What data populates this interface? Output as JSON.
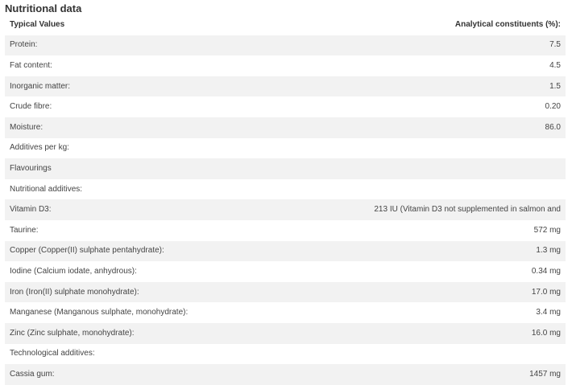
{
  "section": {
    "title": "Nutritional data"
  },
  "table": {
    "headers": {
      "label": "Typical Values",
      "value": "Analytical constituents (%):"
    },
    "rows": [
      {
        "label": "Protein:",
        "value": "7.5"
      },
      {
        "label": "Fat content:",
        "value": "4.5"
      },
      {
        "label": "Inorganic matter:",
        "value": "1.5"
      },
      {
        "label": "Crude fibre:",
        "value": "0.20"
      },
      {
        "label": "Moisture:",
        "value": "86.0"
      },
      {
        "label": "Additives per kg:",
        "value": ""
      },
      {
        "label": "Flavourings",
        "value": ""
      },
      {
        "label": "Nutritional additives:",
        "value": ""
      },
      {
        "label": "Vitamin D3:",
        "value": "213 IU (Vitamin D3 not supplemented in salmon and"
      },
      {
        "label": "Taurine:",
        "value": "572 mg"
      },
      {
        "label": "Copper (Copper(II) sulphate pentahydrate):",
        "value": "1.3 mg"
      },
      {
        "label": "Iodine (Calcium iodate, anhydrous):",
        "value": "0.34 mg"
      },
      {
        "label": "Iron (Iron(II) sulphate monohydrate):",
        "value": "17.0 mg"
      },
      {
        "label": "Manganese (Manganous sulphate, monohydrate):",
        "value": "3.4 mg"
      },
      {
        "label": "Zinc (Zinc sulphate, monohydrate):",
        "value": "16.0 mg"
      },
      {
        "label": "Technological additives:",
        "value": ""
      },
      {
        "label": "Cassia gum:",
        "value": "1457 mg"
      }
    ]
  }
}
